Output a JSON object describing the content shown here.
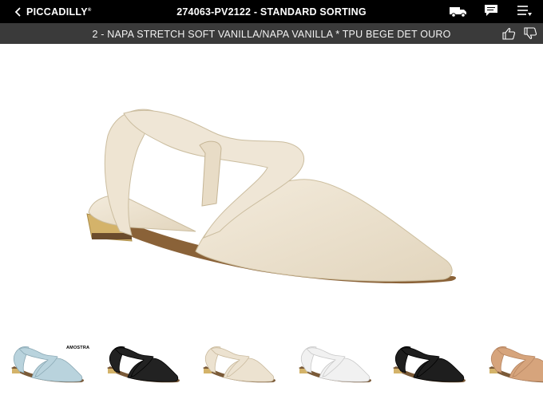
{
  "header": {
    "back_label": "PICCADILLY",
    "brand_mark": "®",
    "title": "274063-PV2122 -  STANDARD SORTING",
    "icons": [
      "truck-icon",
      "chat-icon",
      "menu-icon"
    ]
  },
  "subheader": {
    "description": "2 - NAPA STRETCH SOFT VANILLA/NAPA VANILLA * TPU BEGE DET OURO",
    "icons": [
      "thumbs-up-icon",
      "thumbs-down-icon"
    ]
  },
  "main_product": {
    "color": "#ece2d0",
    "sole_color": "#8a6238",
    "heel_color": "#d4b36a"
  },
  "thumbnails": {
    "badge": "AMOSTRA",
    "items": [
      {
        "color": "#b9d3dd",
        "stroke": "#8aa8b4"
      },
      {
        "color": "#222222",
        "stroke": "#000000"
      },
      {
        "color": "#ece2d0",
        "stroke": "#c9b99c"
      },
      {
        "color": "#f1f1f1",
        "stroke": "#c8c8c8"
      },
      {
        "color": "#1e1e1e",
        "stroke": "#000000"
      },
      {
        "color": "#d6a47c",
        "stroke": "#b58460"
      }
    ]
  }
}
